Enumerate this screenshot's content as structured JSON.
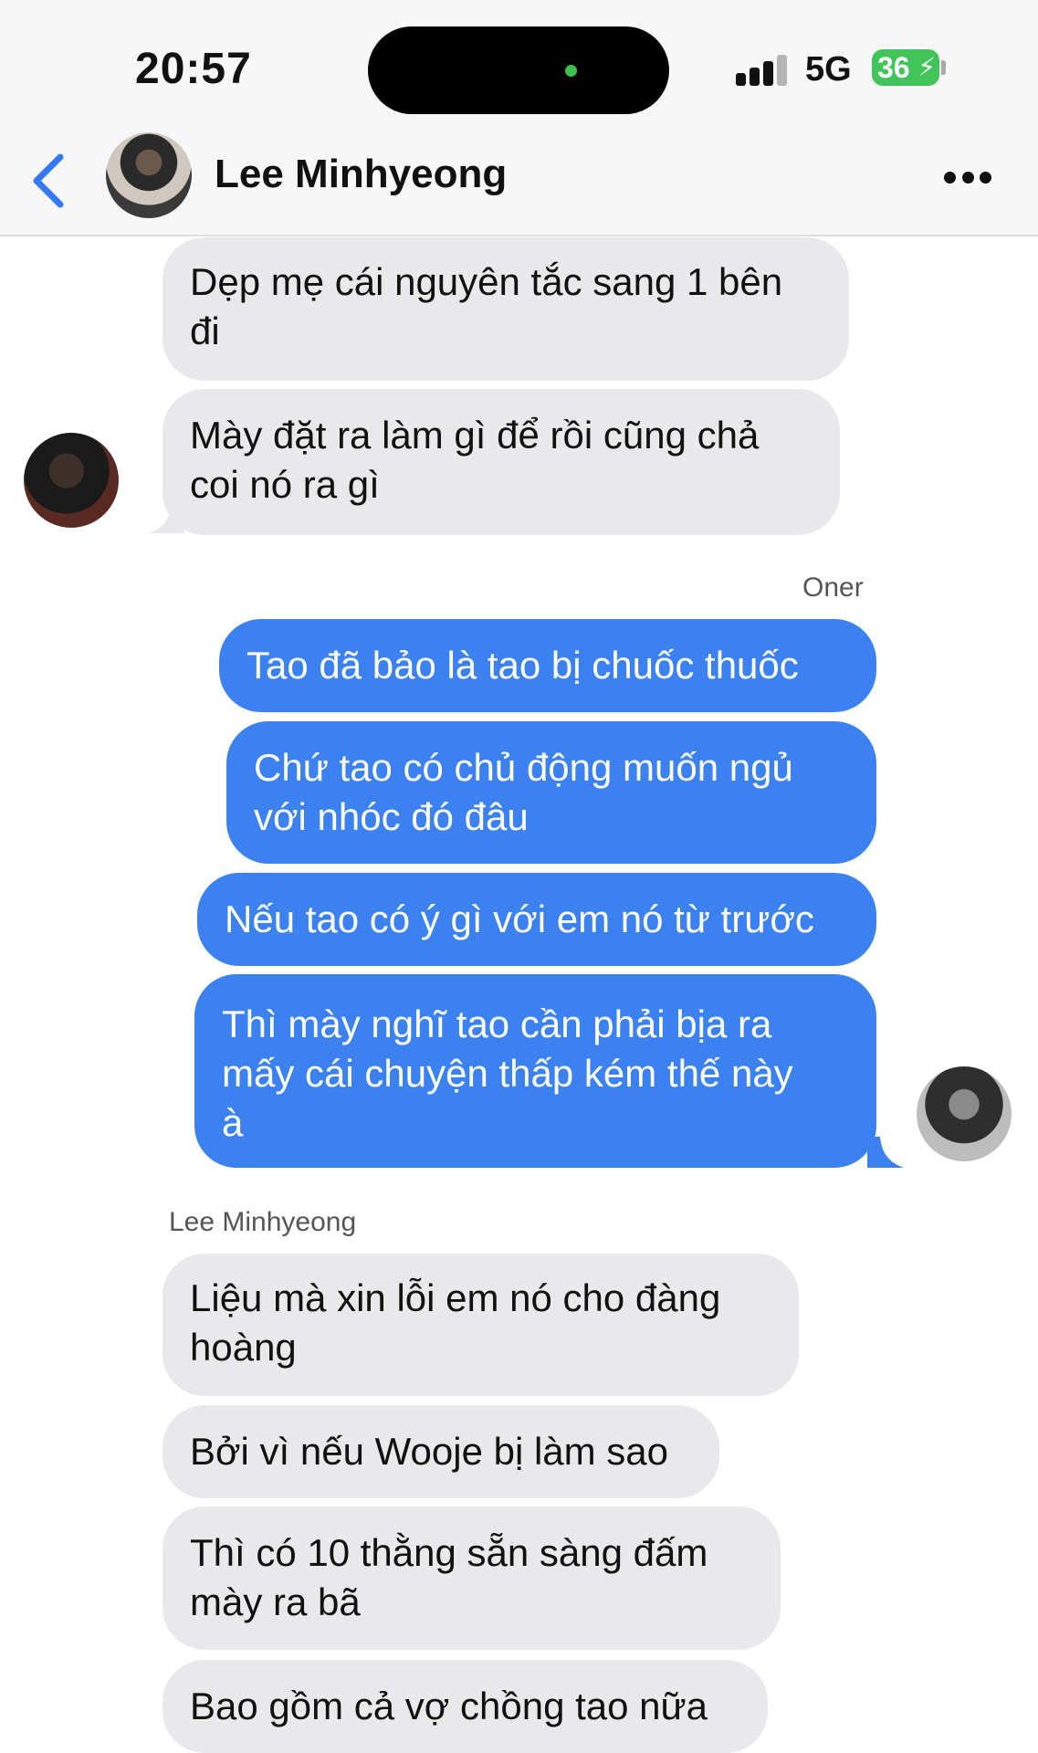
{
  "status": {
    "time": "20:57",
    "network": "5G",
    "battery": "36"
  },
  "header": {
    "contact_name": "Lee Minhyeong"
  },
  "labels": {
    "oner": "Oner",
    "lee": "Lee Minhyeong"
  },
  "messages": [
    {
      "side": "in",
      "text": "Dẹp mẹ cái nguyên tắc sang 1 bên\nđi"
    },
    {
      "side": "in",
      "text": "Mày đặt ra làm gì để rồi cũng chả\ncoi nó ra gì"
    },
    {
      "side": "out",
      "text": "Tao đã bảo là tao bị chuốc thuốc"
    },
    {
      "side": "out",
      "text": "Chứ tao có chủ động muốn ngủ\nvới nhóc đó đâu"
    },
    {
      "side": "out",
      "text": "Nếu tao có ý gì với em nó từ trước"
    },
    {
      "side": "out",
      "text": "Thì mày nghĩ tao cần phải bịa ra\nmấy cái chuyện thấp kém thế này\nà"
    },
    {
      "side": "in",
      "text": "Liệu mà xin lỗi em nó cho đàng\nhoàng"
    },
    {
      "side": "in",
      "text": "Bởi vì nếu Wooje bị làm sao"
    },
    {
      "side": "in",
      "text": "Thì có 10 thằng sẵn sàng đấm\nmày ra bã"
    },
    {
      "side": "in",
      "text": "Bao gồm cả vợ chồng tao nữa"
    }
  ],
  "colors": {
    "outgoing": "#3b82f0",
    "incoming": "#e9e9eb",
    "accent": "#3478f6"
  },
  "icons": {
    "back": "chevron-left-icon",
    "more": "more-options-icon"
  }
}
